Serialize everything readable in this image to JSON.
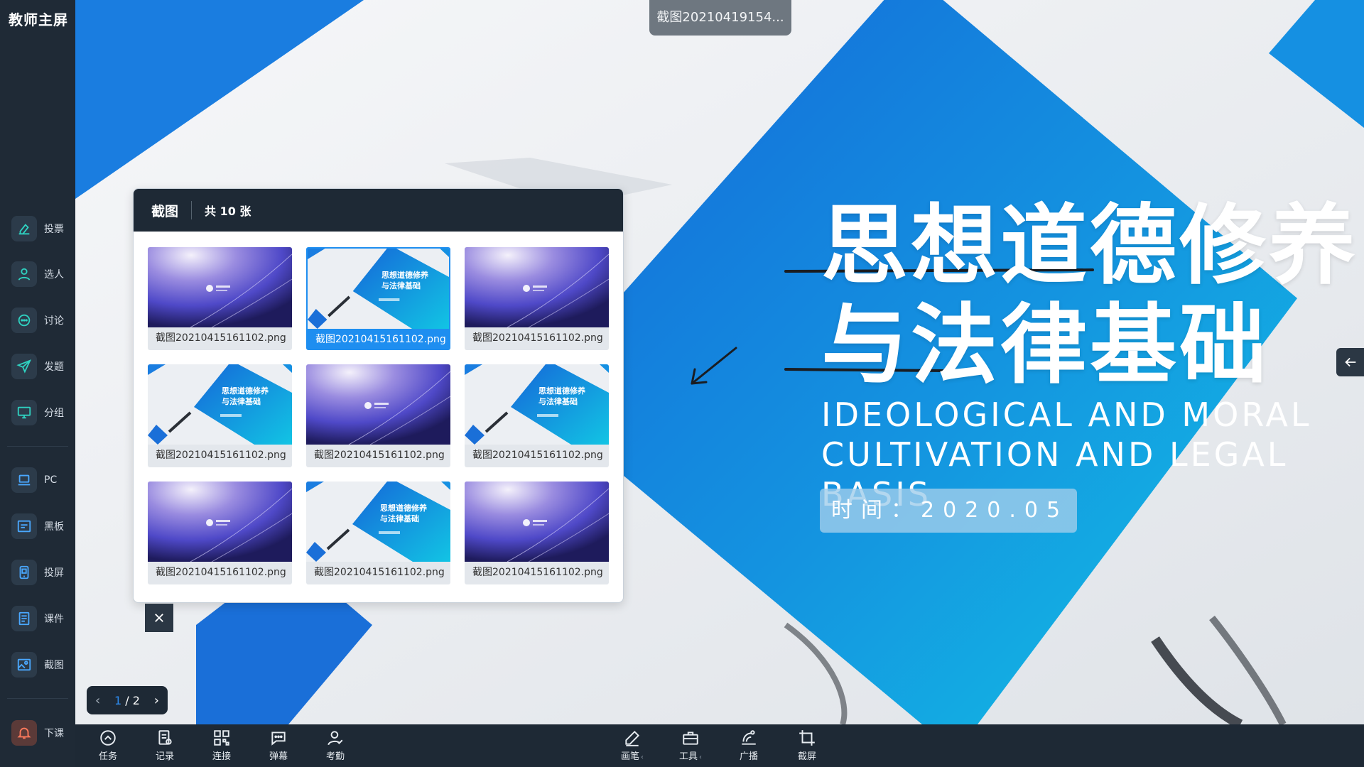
{
  "app": {
    "title": "教师主屏"
  },
  "sidebar": {
    "items": [
      {
        "label": "投票",
        "icon": "vote-icon"
      },
      {
        "label": "选人",
        "icon": "user-pick-icon"
      },
      {
        "label": "讨论",
        "icon": "chat-icon"
      },
      {
        "label": "发题",
        "icon": "send-icon"
      },
      {
        "label": "分组",
        "icon": "group-icon"
      },
      {
        "label": "PC",
        "icon": "laptop-icon"
      },
      {
        "label": "黑板",
        "icon": "board-icon"
      },
      {
        "label": "投屏",
        "icon": "cast-icon"
      },
      {
        "label": "课件",
        "icon": "courseware-icon"
      },
      {
        "label": "截图",
        "icon": "image-icon"
      },
      {
        "label": "下课",
        "icon": "bell-icon"
      }
    ]
  },
  "stage": {
    "file_tab": "截图20210419154...",
    "slide": {
      "title_line1": "思想道德修养",
      "title_line2": "与法律基础",
      "subtitle_line1": "IDEOLOGICAL AND MORAL",
      "subtitle_line2": "CULTIVATION AND LEGAL BASIS",
      "date": "时间：2020.05"
    },
    "colors": {
      "primary_blue": "#1565d8",
      "accent_cyan": "#12c4e4"
    }
  },
  "screenshot_panel": {
    "title": "截图",
    "count_label": "共 10 张",
    "selected_index": 1,
    "thumbnails": [
      {
        "name": "截图20210415161102.png",
        "kind": "purple"
      },
      {
        "name": "截图20210415161102.png",
        "kind": "slide",
        "slide_title": "思想道德修养\n与法律基础"
      },
      {
        "name": "截图20210415161102.png",
        "kind": "purple"
      },
      {
        "name": "截图20210415161102.png",
        "kind": "slide",
        "slide_title": "思想道德修养\n与法律基础"
      },
      {
        "name": "截图20210415161102.png",
        "kind": "purple"
      },
      {
        "name": "截图20210415161102.png",
        "kind": "slide",
        "slide_title": "思想道德修养\n与法律基础"
      },
      {
        "name": "截图20210415161102.png",
        "kind": "purple"
      },
      {
        "name": "截图20210415161102.png",
        "kind": "slide",
        "slide_title": "思想道德修养\n与法律基础"
      },
      {
        "name": "截图20210415161102.png",
        "kind": "purple"
      }
    ]
  },
  "pager": {
    "current": "1",
    "separator": "/",
    "total": "2"
  },
  "toolbar": {
    "left": [
      {
        "label": "任务",
        "icon": "task-icon"
      },
      {
        "label": "记录",
        "icon": "record-icon"
      },
      {
        "label": "连接",
        "icon": "qrcode-icon"
      },
      {
        "label": "弹幕",
        "icon": "danmaku-icon"
      },
      {
        "label": "考勤",
        "icon": "attendance-icon"
      }
    ],
    "center": [
      {
        "label": "画笔",
        "icon": "pen-icon",
        "has_caret": true
      },
      {
        "label": "工具",
        "icon": "toolbox-icon",
        "has_caret": true
      },
      {
        "label": "广播",
        "icon": "broadcast-icon",
        "has_caret": false
      },
      {
        "label": "截屏",
        "icon": "crop-icon",
        "has_caret": false
      }
    ]
  }
}
